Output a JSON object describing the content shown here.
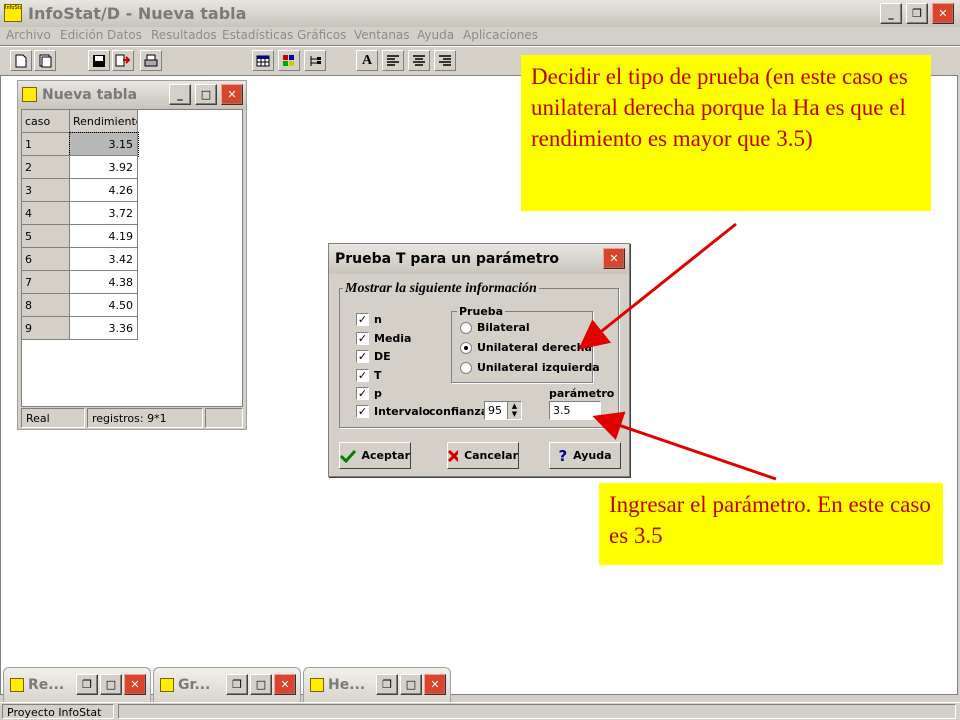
{
  "app": {
    "title": "InfoStat/D - Nueva tabla",
    "logo_text": "InfoStat"
  },
  "menu": [
    "Archivo",
    "Edición",
    "Datos",
    "Resultados",
    "Estadísticas",
    "Gráficos",
    "Ventanas",
    "Ayuda",
    "Aplicaciones"
  ],
  "toolbar_icons": [
    "new-file-icon",
    "open-file-icon",
    "save-icon",
    "export-icon",
    "print-icon",
    "grid-icon",
    "palette-icon",
    "tree-icon",
    "bold-icon",
    "align-left-icon",
    "align-center-icon",
    "align-right-icon"
  ],
  "table_window": {
    "title": "Nueva tabla",
    "columns": [
      "caso",
      "Rendimiento"
    ],
    "rows": [
      [
        "1",
        "3.15"
      ],
      [
        "2",
        "3.92"
      ],
      [
        "3",
        "4.26"
      ],
      [
        "4",
        "3.72"
      ],
      [
        "5",
        "4.19"
      ],
      [
        "6",
        "3.42"
      ],
      [
        "7",
        "4.38"
      ],
      [
        "8",
        "4.50"
      ],
      [
        "9",
        "3.36"
      ]
    ],
    "status_type": "Real",
    "status_records": "registros: 9*1"
  },
  "dialog": {
    "title": "Prueba T para un parámetro",
    "group_label": "Mostrar la siguiente información",
    "checks": [
      {
        "label": "n",
        "checked": true
      },
      {
        "label": "Media",
        "checked": true
      },
      {
        "label": "DE",
        "checked": true
      },
      {
        "label": "T",
        "checked": true
      },
      {
        "label": "p",
        "checked": true
      },
      {
        "label": "Intervalo",
        "checked": true
      }
    ],
    "confidence_label": "confianza",
    "confidence_value": "95",
    "prueba_label": "Prueba",
    "prueba_options": [
      {
        "label": "Bilateral",
        "selected": false
      },
      {
        "label": "Unilateral derecha",
        "selected": true
      },
      {
        "label": "Unilateral izquierda",
        "selected": false
      }
    ],
    "param_label": "parámetro",
    "param_value": "3.5",
    "btn_accept": "Aceptar",
    "btn_cancel": "Cancelar",
    "btn_help": "Ayuda"
  },
  "callouts": {
    "top": "Decidir el tipo de prueba (en este caso es unilateral derecha porque la Ha es que el rendimiento es mayor que 3.5)",
    "bottom": "Ingresar el parámetro. En este caso es 3.5"
  },
  "taskbar": {
    "windows": [
      "Re...",
      "Gr...",
      "He..."
    ],
    "project": "Proyecto InfoStat"
  },
  "colors": {
    "callout_bg": "#ffff00",
    "callout_text": "#c00000",
    "arrow": "#e00000"
  }
}
